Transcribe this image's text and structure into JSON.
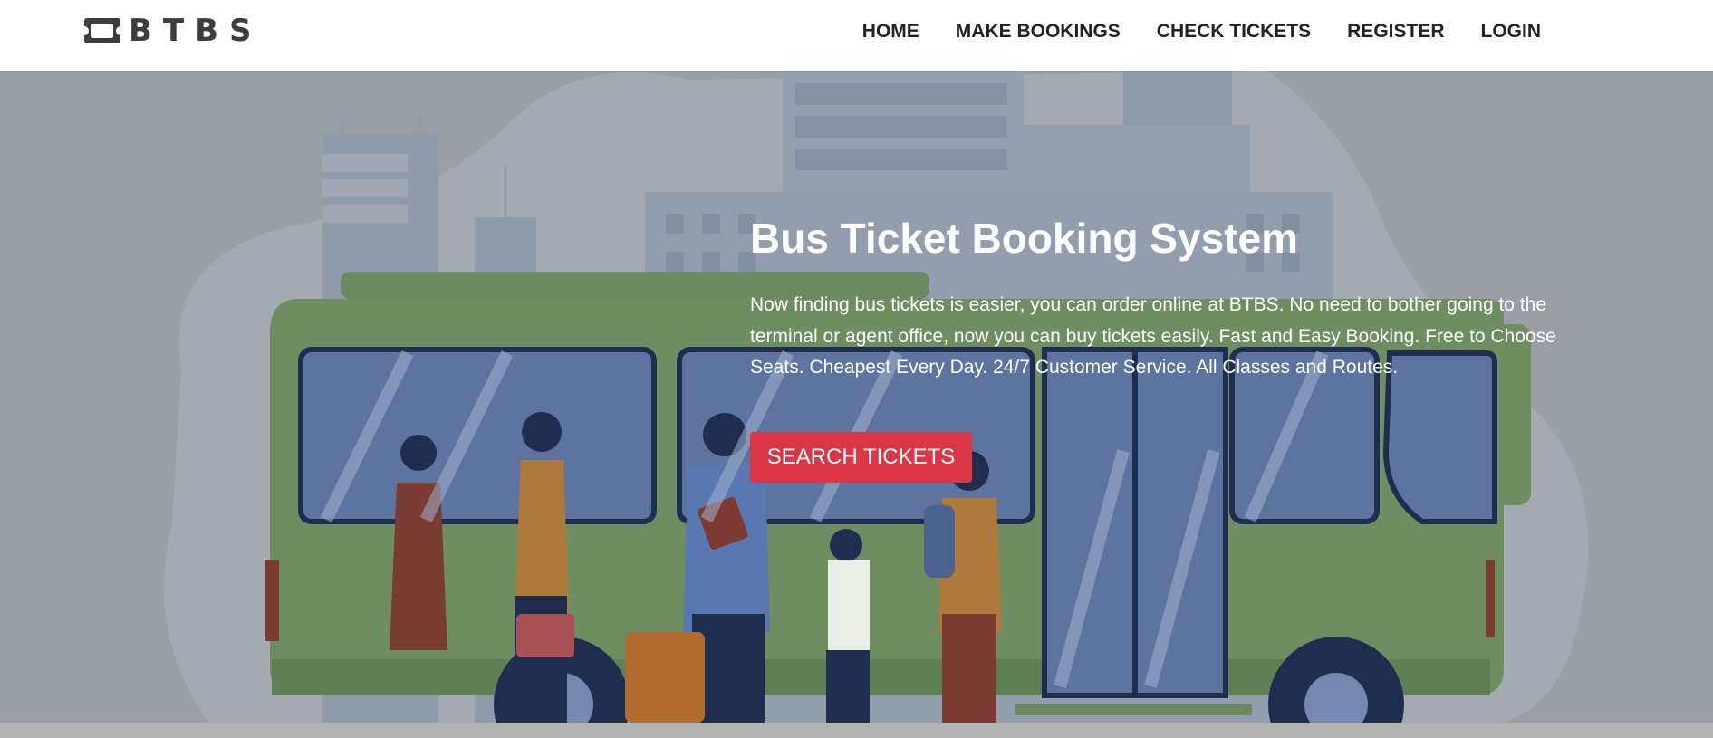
{
  "brand": {
    "name": "BTBS",
    "icon": "ticket-icon"
  },
  "nav": {
    "items": [
      {
        "label": "HOME"
      },
      {
        "label": "MAKE BOOKINGS"
      },
      {
        "label": "CHECK TICKETS"
      },
      {
        "label": "REGISTER"
      },
      {
        "label": "LOGIN"
      }
    ]
  },
  "hero": {
    "title": "Bus Ticket Booking System",
    "description": "Now finding bus tickets is easier, you can order online at BTBS. No need to bother going to the terminal or agent office, now you can buy tickets easily. Fast and Easy Booking. Free to Choose Seats. Cheapest Every Day. 24/7 Customer Service. All Classes and Routes.",
    "button_label": "SEARCH TICKETS",
    "illustration": "bus-with-passengers-illustration"
  },
  "colors": {
    "accent": "#dc3545",
    "nav_text": "#222222",
    "brand_text": "#3d3d3d",
    "hero_bg": "#9a9ea5"
  }
}
